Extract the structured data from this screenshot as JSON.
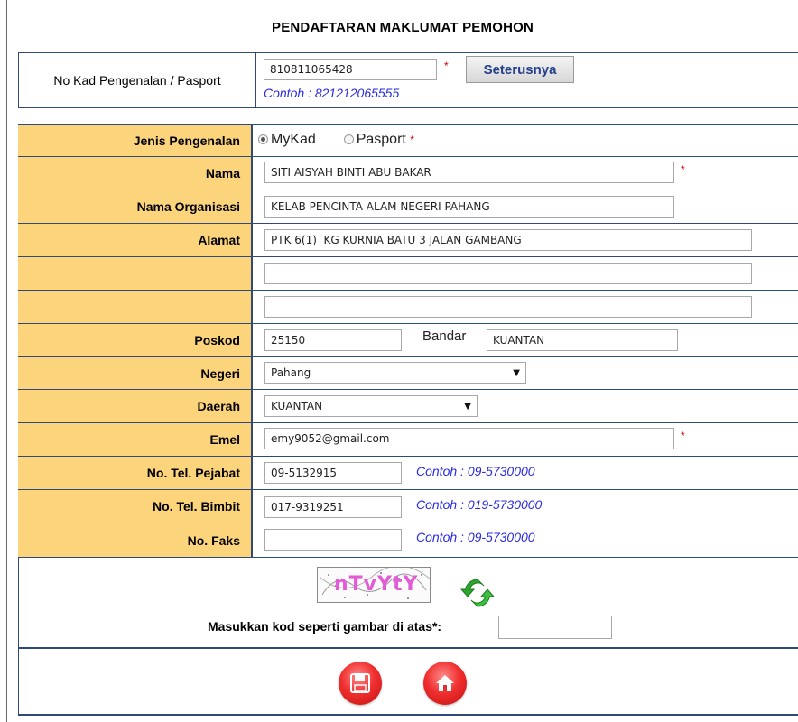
{
  "title": "PENDAFTARAN MAKLUMAT PEMOHON",
  "id_section": {
    "label": "No Kad Pengenalan / Pasport",
    "value": "810811065428",
    "required_mark": "*",
    "next_button": "Seterusnya",
    "example": "Contoh : 821212065555"
  },
  "form": {
    "jenis": {
      "label": "Jenis Pengenalan",
      "options": [
        "MyKad",
        "Pasport"
      ],
      "selected": "MyKad",
      "required_mark": "*"
    },
    "nama": {
      "label": "Nama",
      "value": "SITI AISYAH BINTI ABU BAKAR",
      "required_mark": "*"
    },
    "organisasi": {
      "label": "Nama Organisasi",
      "value": "KELAB PENCINTA ALAM NEGERI PAHANG"
    },
    "alamat": {
      "label": "Alamat",
      "line1": "PTK 6(1)  KG KURNIA BATU 3 JALAN GAMBANG",
      "line2": "",
      "line3": ""
    },
    "poskod": {
      "label": "Poskod",
      "value": "25150",
      "bandar_label": "Bandar",
      "bandar_value": "KUANTAN"
    },
    "negeri": {
      "label": "Negeri",
      "value": "Pahang"
    },
    "daerah": {
      "label": "Daerah",
      "value": "KUANTAN"
    },
    "emel": {
      "label": "Emel",
      "value": "emy9052@gmail.com",
      "required_mark": "*"
    },
    "tel_pejabat": {
      "label": "No. Tel. Pejabat",
      "value": "09-5132915",
      "example": "Contoh : 09-5730000"
    },
    "tel_bimbit": {
      "label": "No. Tel. Bimbit",
      "value": "017-9319251",
      "example": "Contoh : 019-5730000"
    },
    "faks": {
      "label": "No. Faks",
      "value": "",
      "example": "Contoh : 09-5730000"
    }
  },
  "captcha": {
    "image_text": "nTvYtY",
    "label": "Masukkan kod seperti gambar di atas*:",
    "value": ""
  },
  "icons": {
    "refresh": "refresh-icon",
    "save": "save-icon",
    "home": "home-icon"
  },
  "colors": {
    "label_bg": "#fcd47c",
    "border": "#2f4a7a",
    "example_text": "#2a2ae0",
    "required": "#d00000",
    "button_red": "#f03030"
  }
}
